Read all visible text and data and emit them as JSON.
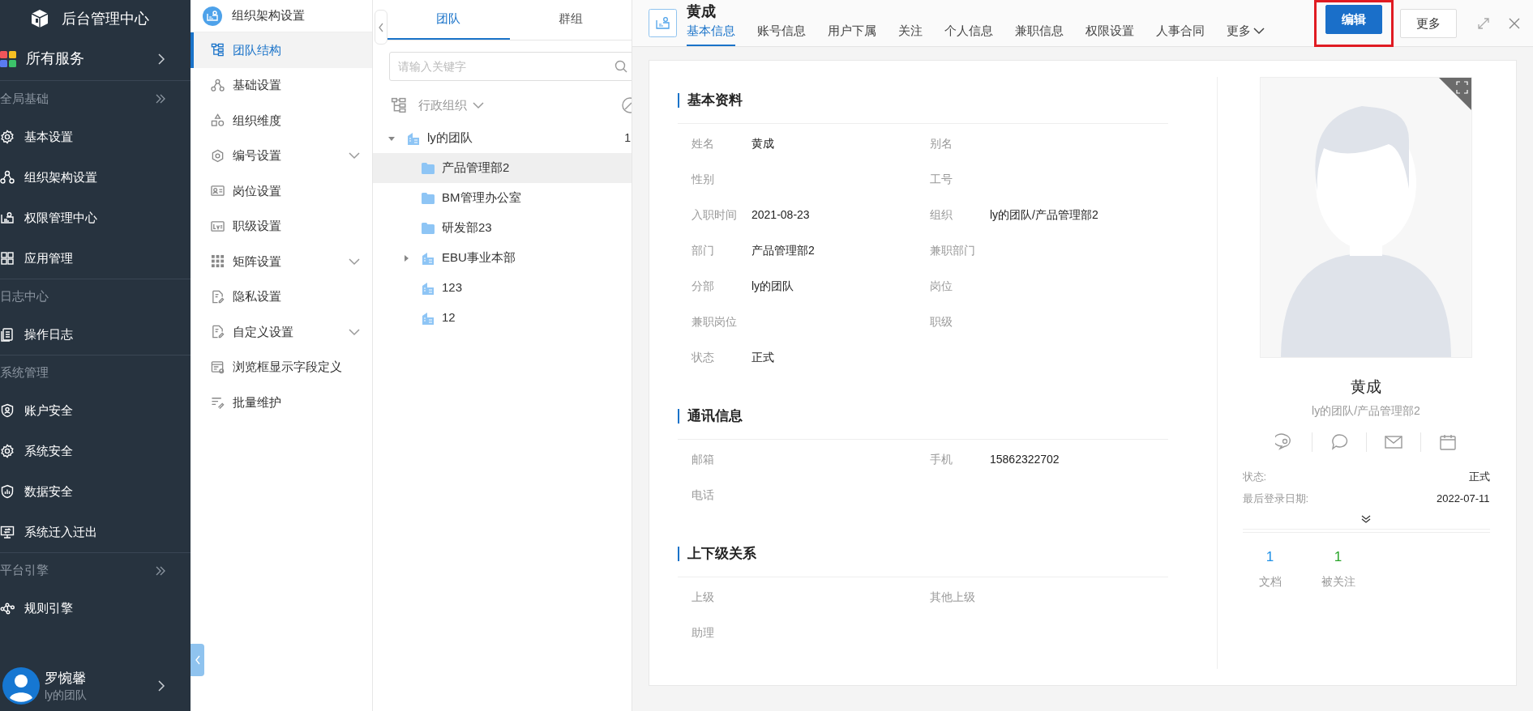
{
  "app_sidebar": {
    "title": "后台管理中心",
    "all_services": "所有服务",
    "sections": [
      {
        "title": "全局基础",
        "collapsible": true,
        "items": [
          {
            "label": "基本设置"
          },
          {
            "label": "组织架构设置"
          },
          {
            "label": "权限管理中心"
          },
          {
            "label": "应用管理"
          }
        ]
      },
      {
        "title": "日志中心",
        "collapsible": false,
        "items": [
          {
            "label": "操作日志"
          }
        ]
      },
      {
        "title": "系统管理",
        "collapsible": false,
        "items": [
          {
            "label": "账户安全"
          },
          {
            "label": "系统安全"
          },
          {
            "label": "数据安全"
          },
          {
            "label": "系统迁入迁出"
          }
        ]
      },
      {
        "title": "平台引擎",
        "collapsible": true,
        "items": [
          {
            "label": "规则引擎"
          }
        ]
      }
    ],
    "user": {
      "name": "罗惋馨",
      "team": "ly的团队"
    }
  },
  "settings_menu": {
    "title": "组织架构设置",
    "items": [
      {
        "label": "团队结构",
        "selected": true,
        "expandable": false
      },
      {
        "label": "基础设置",
        "selected": false,
        "expandable": false
      },
      {
        "label": "组织维度",
        "selected": false,
        "expandable": false
      },
      {
        "label": "编号设置",
        "selected": false,
        "expandable": true
      },
      {
        "label": "岗位设置",
        "selected": false,
        "expandable": false
      },
      {
        "label": "职级设置",
        "selected": false,
        "expandable": false
      },
      {
        "label": "矩阵设置",
        "selected": false,
        "expandable": true
      },
      {
        "label": "隐私设置",
        "selected": false,
        "expandable": false
      },
      {
        "label": "自定义设置",
        "selected": false,
        "expandable": true
      },
      {
        "label": "浏览框显示字段定义",
        "selected": false,
        "expandable": false
      },
      {
        "label": "批量维护",
        "selected": false,
        "expandable": false
      }
    ]
  },
  "org_panel": {
    "tabs": [
      {
        "label": "团队",
        "selected": true
      },
      {
        "label": "群组",
        "selected": false
      }
    ],
    "search": {
      "placeholder": "请输入关键字"
    },
    "dimension": "行政组织",
    "tree": [
      {
        "label": "ly的团队",
        "kind": "org",
        "count": "1",
        "expanded": true,
        "selected": false,
        "children": [
          {
            "label": "产品管理部2",
            "kind": "dept",
            "selected": true
          },
          {
            "label": "BM管理办公室",
            "kind": "dept",
            "selected": false
          },
          {
            "label": "研发部23",
            "kind": "dept",
            "selected": false
          },
          {
            "label": "EBU事业本部",
            "kind": "org",
            "expanded": false,
            "selected": false
          },
          {
            "label": "123",
            "kind": "org",
            "selected": false
          },
          {
            "label": "12",
            "kind": "org",
            "selected": false
          }
        ]
      }
    ]
  },
  "detail": {
    "name": "黄成",
    "tabs": [
      {
        "label": "基本信息",
        "selected": true
      },
      {
        "label": "账号信息",
        "selected": false
      },
      {
        "label": "用户下属",
        "selected": false
      },
      {
        "label": "关注",
        "selected": false
      },
      {
        "label": "个人信息",
        "selected": false
      },
      {
        "label": "兼职信息",
        "selected": false
      },
      {
        "label": "权限设置",
        "selected": false
      },
      {
        "label": "人事合同",
        "selected": false
      },
      {
        "label": "更多",
        "selected": false
      }
    ],
    "buttons": [
      {
        "label": "编辑",
        "kind": "primary",
        "highlighted": true
      },
      {
        "label": "更多",
        "kind": "default",
        "highlighted": false
      }
    ],
    "sections": [
      {
        "title": "基本资料",
        "fields": [
          {
            "label": "姓名",
            "value": "黄成"
          },
          {
            "label": "别名"
          },
          {
            "label": "性别"
          },
          {
            "label": "工号"
          },
          {
            "label": "入职时间",
            "value": "2021-08-23"
          },
          {
            "label": "组织",
            "value": "ly的团队/产品管理部2"
          },
          {
            "label": "部门",
            "value": "产品管理部2"
          },
          {
            "label": "兼职部门"
          },
          {
            "label": "分部",
            "value": "ly的团队"
          },
          {
            "label": "岗位"
          },
          {
            "label": "兼职岗位"
          },
          {
            "label": "职级"
          },
          {
            "label": "状态",
            "value": "正式"
          }
        ]
      },
      {
        "title": "通讯信息",
        "fields": [
          {
            "label": "邮箱"
          },
          {
            "label": "手机",
            "value": "15862322702"
          },
          {
            "label": "电话"
          }
        ]
      },
      {
        "title": "上下级关系",
        "fields": [
          {
            "label": "上级"
          },
          {
            "label": "其他上级"
          },
          {
            "label": "助理"
          }
        ]
      }
    ],
    "profile": {
      "name": "黄成",
      "org": "ly的团队/产品管理部2",
      "info": [
        {
          "label": "状态:",
          "value": "正式"
        },
        {
          "label": "最后登录日期:",
          "value": "2022-07-11"
        }
      ],
      "stats": [
        {
          "value": "1",
          "label": "文档",
          "color": "#1e90e6"
        },
        {
          "value": "1",
          "label": "被关注",
          "color": "#2aa52a"
        }
      ]
    }
  }
}
